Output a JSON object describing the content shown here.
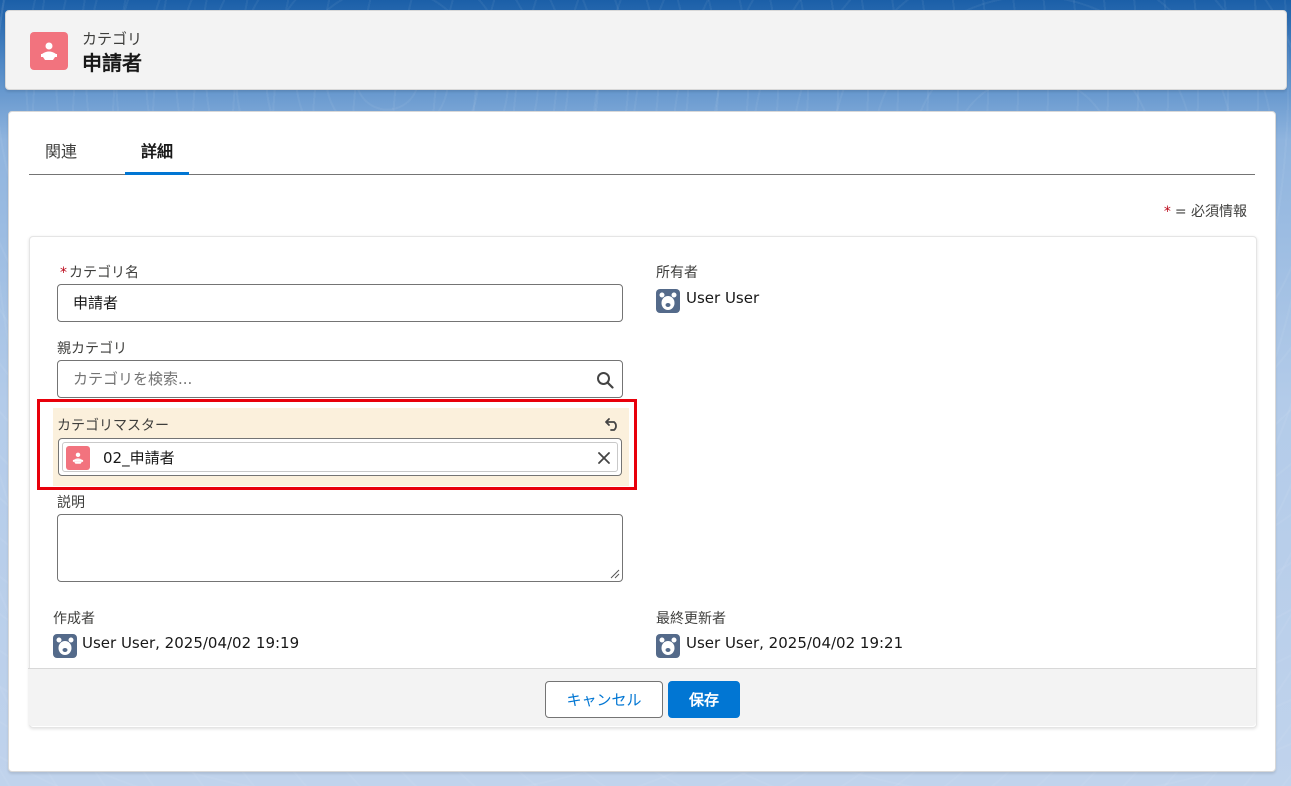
{
  "header": {
    "object_label": "カテゴリ",
    "record_title": "申請者",
    "icon": "category-icon"
  },
  "tabs": [
    {
      "label": "関連",
      "active": false
    },
    {
      "label": "詳細",
      "active": true
    }
  ],
  "required_note": {
    "star": "*",
    "text": "= 必須情報"
  },
  "form": {
    "category_name": {
      "label": "カテゴリ名",
      "required_mark": "*",
      "value": "申請者"
    },
    "parent_category": {
      "label": "親カテゴリ",
      "placeholder": "カテゴリを検索..."
    },
    "category_master": {
      "label": "カテゴリマスター",
      "value": "02_申請者",
      "icon": "category-icon"
    },
    "description": {
      "label": "説明",
      "value": ""
    },
    "owner": {
      "label": "所有者",
      "value": "User User",
      "icon": "user-avatar-icon"
    },
    "created_by": {
      "label": "作成者",
      "value": "User User, 2025/04/02 19:19"
    },
    "last_modified_by": {
      "label": "最終更新者",
      "value": "User User, 2025/04/02 19:21"
    }
  },
  "footer": {
    "cancel_label": "キャンセル",
    "save_label": "保存"
  },
  "colors": {
    "brand": "#0176d3",
    "required": "#ba0517",
    "highlight": "#e8000b",
    "changed_field_bg": "#fbf0dc",
    "category_icon": "#f2737e",
    "user_icon": "#546a8a"
  }
}
